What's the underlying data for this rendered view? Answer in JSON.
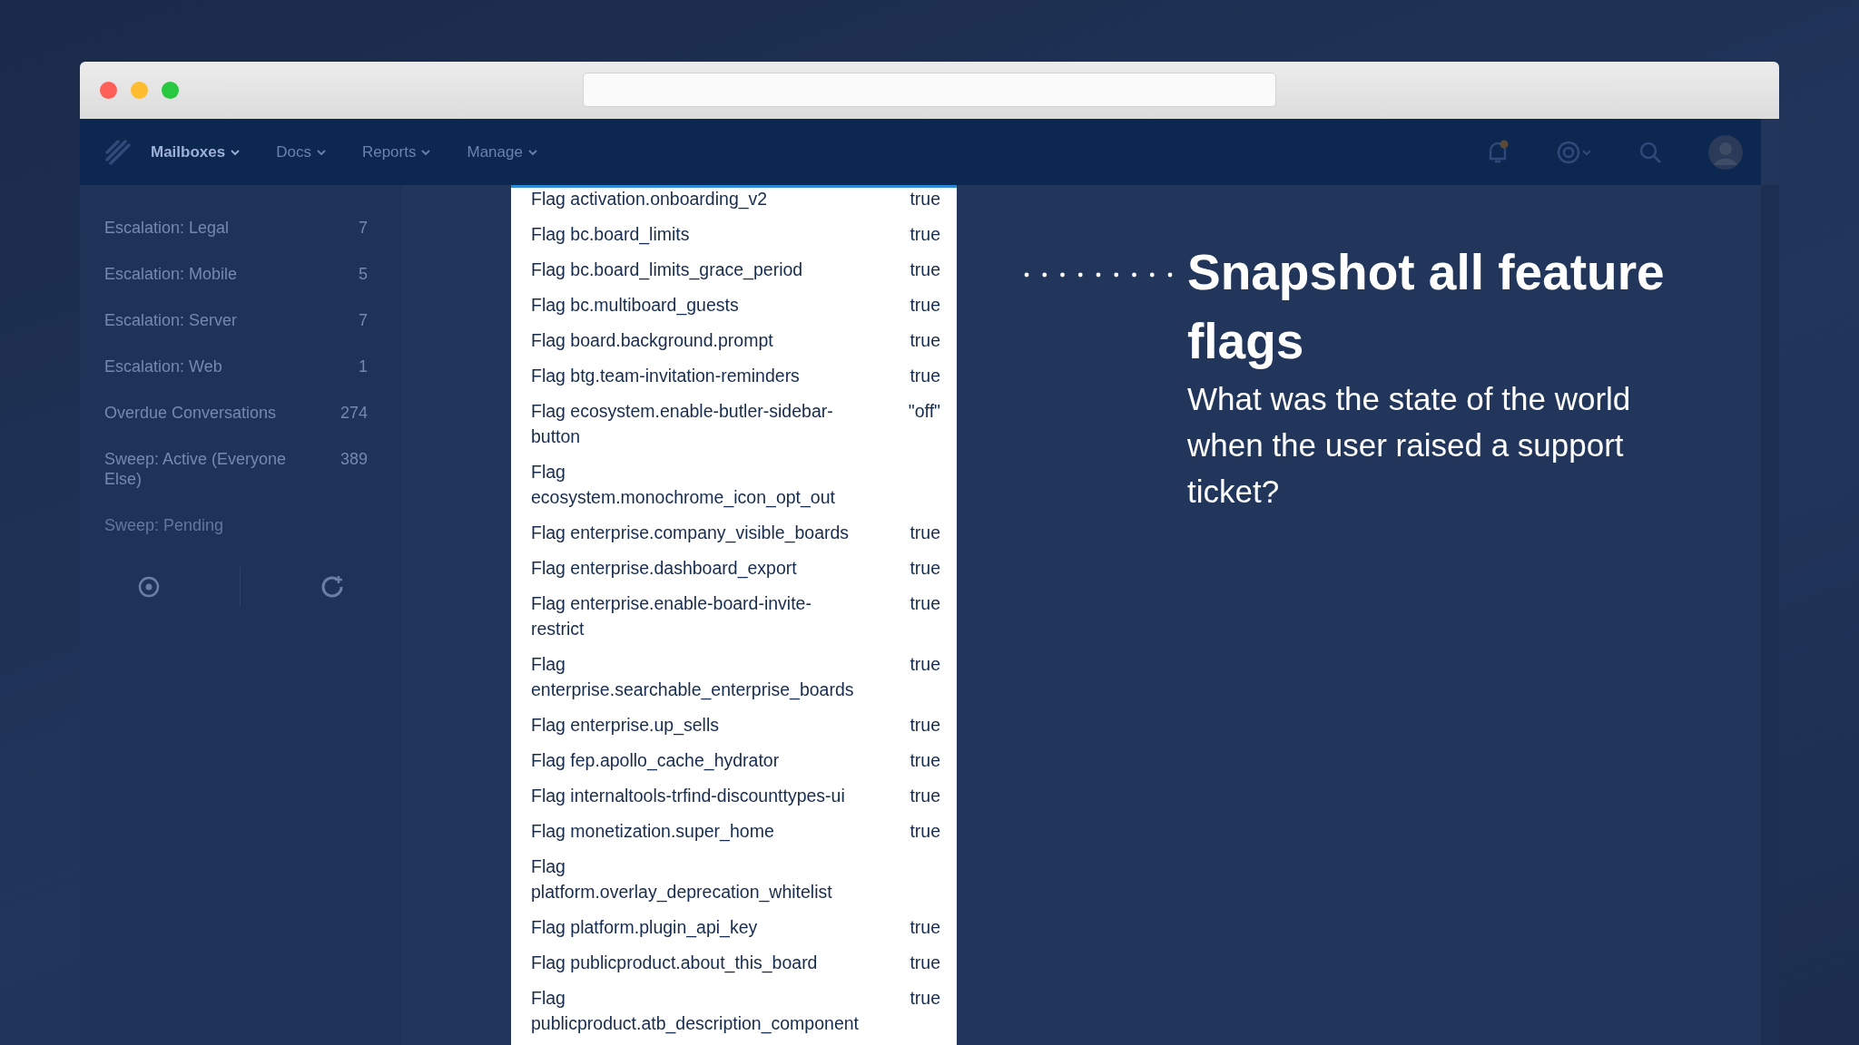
{
  "nav": {
    "items": [
      {
        "label": "Mailboxes",
        "selected": true
      },
      {
        "label": "Docs",
        "selected": false
      },
      {
        "label": "Reports",
        "selected": false
      },
      {
        "label": "Manage",
        "selected": false
      }
    ]
  },
  "sidebar": {
    "items": [
      {
        "label": "Escalation: Legal",
        "count": "7"
      },
      {
        "label": "Escalation: Mobile",
        "count": "5"
      },
      {
        "label": "Escalation: Server",
        "count": "7"
      },
      {
        "label": "Escalation: Web",
        "count": "1"
      },
      {
        "label": "Overdue Conversations",
        "count": "274"
      },
      {
        "label": "Sweep: Active (Everyone Else)",
        "count": "389"
      },
      {
        "label": "Sweep: Pending"
      }
    ]
  },
  "flags": [
    {
      "name": "Flag activation.onboarding_v2",
      "value": "true"
    },
    {
      "name": "Flag bc.board_limits",
      "value": "true"
    },
    {
      "name": "Flag bc.board_limits_grace_period",
      "value": "true"
    },
    {
      "name": "Flag bc.multiboard_guests",
      "value": "true"
    },
    {
      "name": "Flag board.background.prompt",
      "value": "true"
    },
    {
      "name": "Flag btg.team-invitation-reminders",
      "value": "true"
    },
    {
      "name": "Flag ecosystem.enable-butler-sidebar-button",
      "value": "\"off\""
    },
    {
      "name": "Flag ecosystem.monochrome_icon_opt_out"
    },
    {
      "name": "Flag enterprise.company_visible_boards",
      "value": "true"
    },
    {
      "name": "Flag enterprise.dashboard_export",
      "value": "true"
    },
    {
      "name": "Flag enterprise.enable-board-invite-restrict",
      "value": "true"
    },
    {
      "name": "Flag enterprise.searchable_enterprise_boards",
      "value": "true"
    },
    {
      "name": "Flag enterprise.up_sells",
      "value": "true"
    },
    {
      "name": "Flag fep.apollo_cache_hydrator",
      "value": "true"
    },
    {
      "name": "Flag internaltools-trfind-discounttypes-ui",
      "value": "true"
    },
    {
      "name": "Flag monetization.super_home",
      "value": "true"
    },
    {
      "name": "Flag platform.overlay_deprecation_whitelist"
    },
    {
      "name": "Flag platform.plugin_api_key",
      "value": "true"
    },
    {
      "name": "Flag publicproduct.about_this_board",
      "value": "true"
    },
    {
      "name": "Flag publicproduct.atb_description_component",
      "value": "true"
    }
  ],
  "callout": {
    "title": "Snapshot all feature flags",
    "subtitle": "What was the state of the world when the user raised a support ticket?"
  }
}
